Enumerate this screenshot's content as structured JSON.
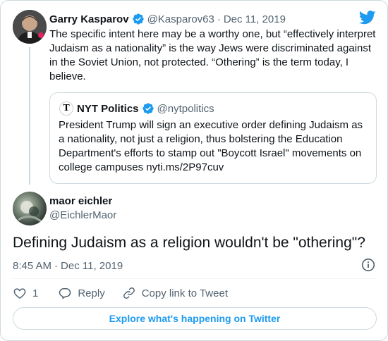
{
  "colors": {
    "accent": "#1d9bf0",
    "secondary_text": "#536471",
    "primary_text": "#0f1419",
    "border": "#cfd9de"
  },
  "parent_tweet": {
    "author_name": "Garry Kasparov",
    "author_handle": "@Kasparov63",
    "separator": "·",
    "date": "Dec 11, 2019",
    "text": "The specific intent here may be a worthy one, but “effectively interpret Judaism as a nationality” is the way Jews were discriminated against in the Soviet Union, not protected. “Othering” is the term today, I believe."
  },
  "quoted_tweet": {
    "logo_glyph": "T",
    "author_name": "NYT Politics",
    "author_handle": "@nytpolitics",
    "text": "President Trump will sign an executive order defining Judaism as a nationality, not just a religion, thus bolstering the Education Department's efforts to stamp out \"Boycott Israel\" movements on college campuses nyti.ms/2P97cuv"
  },
  "main_tweet": {
    "author_name": "maor eichler",
    "author_handle": "@EichlerMaor",
    "text": "Defining Judaism as a religion wouldn't be \"othering\"?",
    "time": "8:45 AM",
    "separator": "·",
    "date": "Dec 11, 2019"
  },
  "actions": {
    "like_count": "1",
    "reply_label": "Reply",
    "copy_link_label": "Copy link to Tweet"
  },
  "explore_label": "Explore what's happening on Twitter",
  "icons": [
    "verified-badge-icon",
    "twitter-logo-icon",
    "info-icon",
    "heart-icon",
    "reply-icon",
    "link-icon"
  ]
}
